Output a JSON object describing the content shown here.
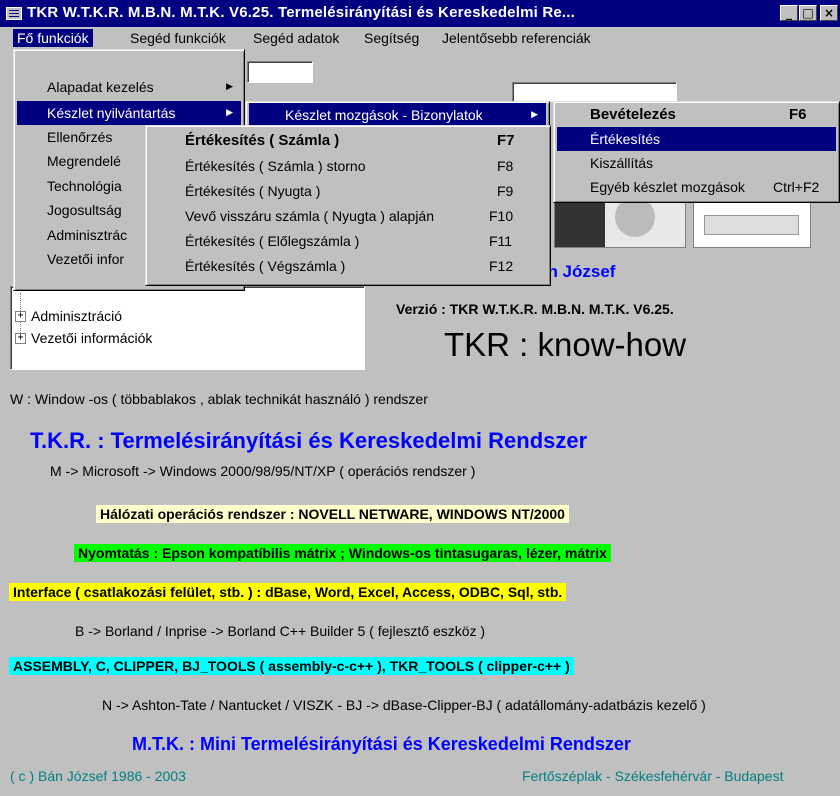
{
  "window": {
    "title": "TKR W.T.K.R. M.B.N. M.T.K. V6.25. Termelésirányítási és Kereskedelmi Re...",
    "min_glyph": "_",
    "max_glyph": "□",
    "close_glyph": "×"
  },
  "menubar": {
    "items": [
      "Fő funkciók",
      "Segéd funkciók",
      "Segéd adatok",
      "Segítség",
      "Jelentősebb referenciák"
    ]
  },
  "menu_main": {
    "items": [
      {
        "label": "Alapadat kezelés",
        "arrow": "▶"
      },
      {
        "label": "Készlet nyilvántartás",
        "arrow": "▶"
      },
      {
        "label": "Ellenőrzés"
      },
      {
        "label": "Megrendelé"
      },
      {
        "label": "Technológia"
      },
      {
        "label": "Jogosultság"
      },
      {
        "label": "Adminisztrác"
      },
      {
        "label": "Vezetői infor"
      }
    ]
  },
  "menu_keszlet": {
    "items": [
      {
        "label": "Készlet mozgások - Bizonylatok",
        "arrow": "▶"
      }
    ]
  },
  "menu_bizonylat": {
    "items": [
      {
        "label": "Bevételezés",
        "shortcut": "F6"
      },
      {
        "label": "Értékesítés",
        "shortcut": ""
      },
      {
        "label": "Kiszállítás",
        "shortcut": ""
      },
      {
        "label": "Egyéb készlet mozgások",
        "shortcut": "Ctrl+F2"
      }
    ]
  },
  "menu_ertekesites": {
    "items": [
      {
        "label": "Értékesítés ( Számla )",
        "shortcut": "F7"
      },
      {
        "label": "Értékesítés ( Számla ) storno",
        "shortcut": "F8"
      },
      {
        "label": "Értékesítés ( Nyugta )",
        "shortcut": "F9"
      },
      {
        "label": "Vevő visszáru számla ( Nyugta ) alapján",
        "shortcut": "F10"
      },
      {
        "label": "Értékesítés ( Előlegszámla )",
        "shortcut": "F11"
      },
      {
        "label": "Értékesítés ( Végszámla )",
        "shortcut": "F12"
      }
    ]
  },
  "tree": {
    "items": [
      {
        "label": "Adminisztráció",
        "expander": "+"
      },
      {
        "label": "Vezetői információk",
        "expander": "+"
      }
    ]
  },
  "content": {
    "author_partial": "án József",
    "version": "Verzió : TKR W.T.K.R. M.B.N. M.T.K. V6.25.",
    "knowhow": "TKR :  know-how",
    "w_line": "W : Window -os ( többablakos , ablak technikát használó ) rendszer",
    "tkr_line": "T.K.R. : Termelésirányítási és Kereskedelmi Rendszer",
    "m_line": "M -> Microsoft -> Windows 2000/98/95/NT/XP        ( operációs rendszer )",
    "network": "Hálózati operációs rendszer : NOVELL NETWARE, WINDOWS NT/2000",
    "print": "Nyomtatás : Epson kompatíbilis mátrix ;  Windows-os tintasugaras, lézer, mátrix",
    "interface": "Interface ( csatlakozási felület, stb. )  : dBase, Word, Excel, Access, ODBC, Sql, stb.",
    "b_line": "B -> Borland / Inprise -> Borland C++ Builder 5      ( fejlesztő eszköz )",
    "assembly": "ASSEMBLY, C, CLIPPER, BJ_TOOLS ( assembly-c-c++ ), TKR_TOOLS ( clipper-c++ )",
    "n_line": "N -> Ashton-Tate / Nantucket / VISZK - BJ -> dBase-Clipper-BJ    ( adatállomány-adatbázis kezelő )",
    "mtk_line": "M.T.K.  : Mini Termelésirányítási és Kereskedelmi Rendszer",
    "copyright": "( c ) Bán József 1986 - 2003",
    "places": "Fertőszéplak - Székesfehérvár - Budapest"
  },
  "colors": {
    "network_bg": "#ffffcc",
    "print_bg": "#00ff00",
    "interface_bg": "#ffff00",
    "assembly_bg": "#00ffff",
    "footer_text": "#008080",
    "title_blue": "#0000ff"
  }
}
